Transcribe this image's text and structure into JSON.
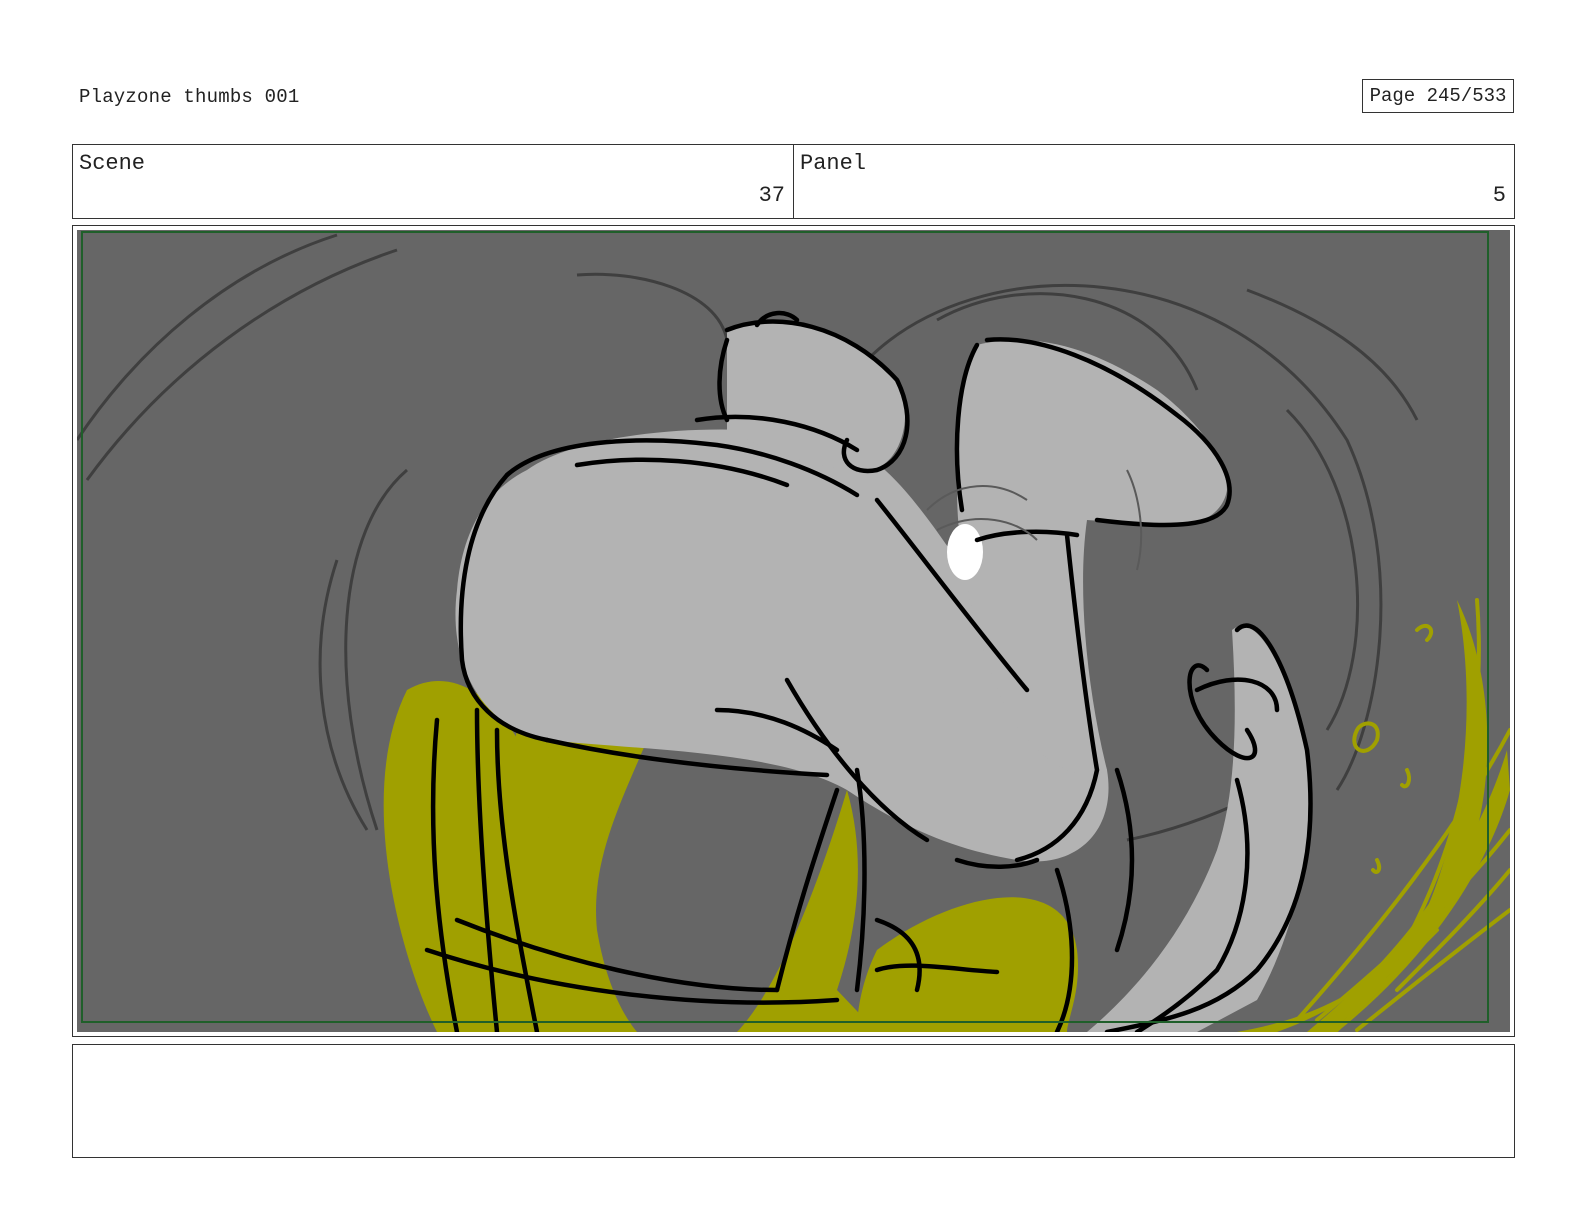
{
  "document": {
    "title": "Playzone thumbs 001",
    "page_label": "Page 245/533"
  },
  "info": {
    "scene_label": "Scene",
    "scene_value": "37",
    "panel_label": "Panel",
    "panel_value": "5"
  },
  "panel": {
    "colors": {
      "background": "#666666",
      "figure_fill": "#b3b3b3",
      "accent_fill": "#a0a000",
      "ink": "#000000",
      "safe_frame": "#1f5f2a"
    }
  },
  "notes": {
    "text": ""
  }
}
